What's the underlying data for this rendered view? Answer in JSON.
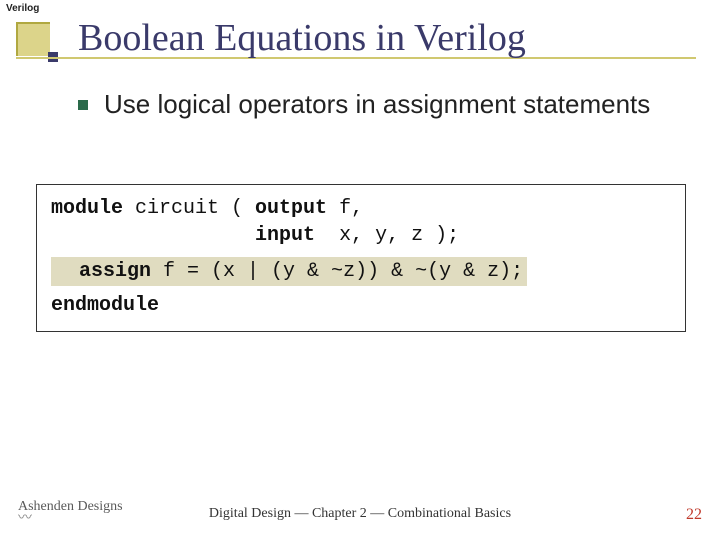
{
  "tag": "Verilog",
  "title": "Boolean Equations in Verilog",
  "bullet": "Use logical operators in assignment statements",
  "code": {
    "l1a": "module",
    "l1b": " circuit ( ",
    "l1c": "output",
    "l1d": " f,",
    "l2a": "                 ",
    "l2b": "input",
    "l2c": "  x, y, z );",
    "l3a": "  ",
    "l3b": "assign",
    "l3c": " f = (x | (y & ~z)) & ~(y & z);",
    "l4": "endmodule"
  },
  "footer": "Digital Design — Chapter 2 — Combinational Basics",
  "page": "22",
  "logo": "Ashenden Designs"
}
